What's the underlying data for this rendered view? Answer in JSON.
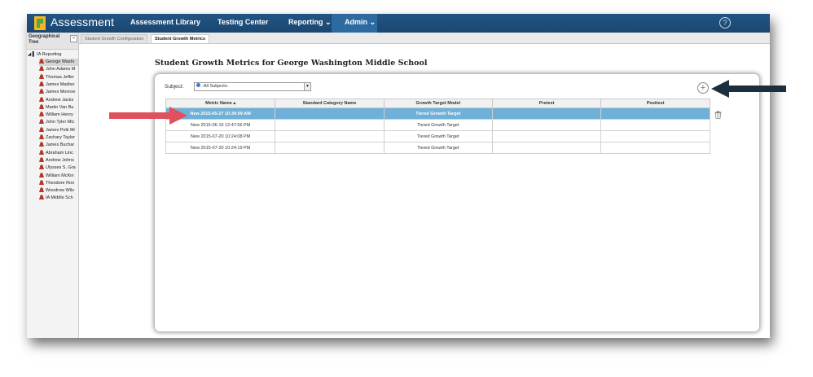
{
  "app": {
    "brand": "Assessment",
    "nav": [
      {
        "label": "Assessment Library"
      },
      {
        "label": "Testing Center"
      },
      {
        "label": "Reporting ⌄"
      },
      {
        "label": "Admin ⌄"
      }
    ],
    "help": "?"
  },
  "sidebar": {
    "title": "Geographical Tree",
    "collapse": "«",
    "root": "◢ ▌ IA Reporting",
    "items": [
      {
        "label": "George Washi"
      },
      {
        "label": "John Adams M"
      },
      {
        "label": "Thomas Jeffer"
      },
      {
        "label": "James Madiso"
      },
      {
        "label": "James Monroe"
      },
      {
        "label": "Andrew Jacks"
      },
      {
        "label": "Martin Van Bu"
      },
      {
        "label": "William Henry"
      },
      {
        "label": "John Tyler Mic"
      },
      {
        "label": "James Polk Mi"
      },
      {
        "label": "Zachary Taylor"
      },
      {
        "label": "James Buchar"
      },
      {
        "label": "Abraham Linc"
      },
      {
        "label": "Andrew Johns"
      },
      {
        "label": "Ulysses S. Gra"
      },
      {
        "label": "William McKin"
      },
      {
        "label": "Theodore Roo"
      },
      {
        "label": "Woodrow Wils"
      },
      {
        "label": "IA Middle Sch"
      }
    ]
  },
  "tabs": [
    {
      "label": "Student Growth Configuration"
    },
    {
      "label": "Student Growth Metrics"
    }
  ],
  "page": {
    "title": "Student Growth Metrics for George Washington Middle School",
    "subject_label": "Subject:",
    "subject_value": "-All Subjects-"
  },
  "table": {
    "headers": [
      "Metric Name ▴",
      "Standard Category Name",
      "Growth Target Model",
      "Pretest",
      "Posttest"
    ],
    "rows": [
      [
        "New 2015-05-27 10:34:09 AM",
        "",
        "Tiered Growth Target",
        "",
        ""
      ],
      [
        "New 2015-06-15 12:47:56 PM",
        "",
        "Tiered Growth Target",
        "",
        ""
      ],
      [
        "New 2015-07-20 10:24:08 PM",
        "",
        "Tiered Growth Target",
        "",
        ""
      ],
      [
        "New 2015-07-20 10:24:19 PM",
        "",
        "Tiered Growth Target",
        "",
        ""
      ]
    ],
    "selected_row": 0
  },
  "colors": {
    "topbar": "#1f4e79",
    "selected_row": "#6fb0d8",
    "red_arrow": "#e0505e",
    "dark_arrow": "#1c2f3f"
  }
}
